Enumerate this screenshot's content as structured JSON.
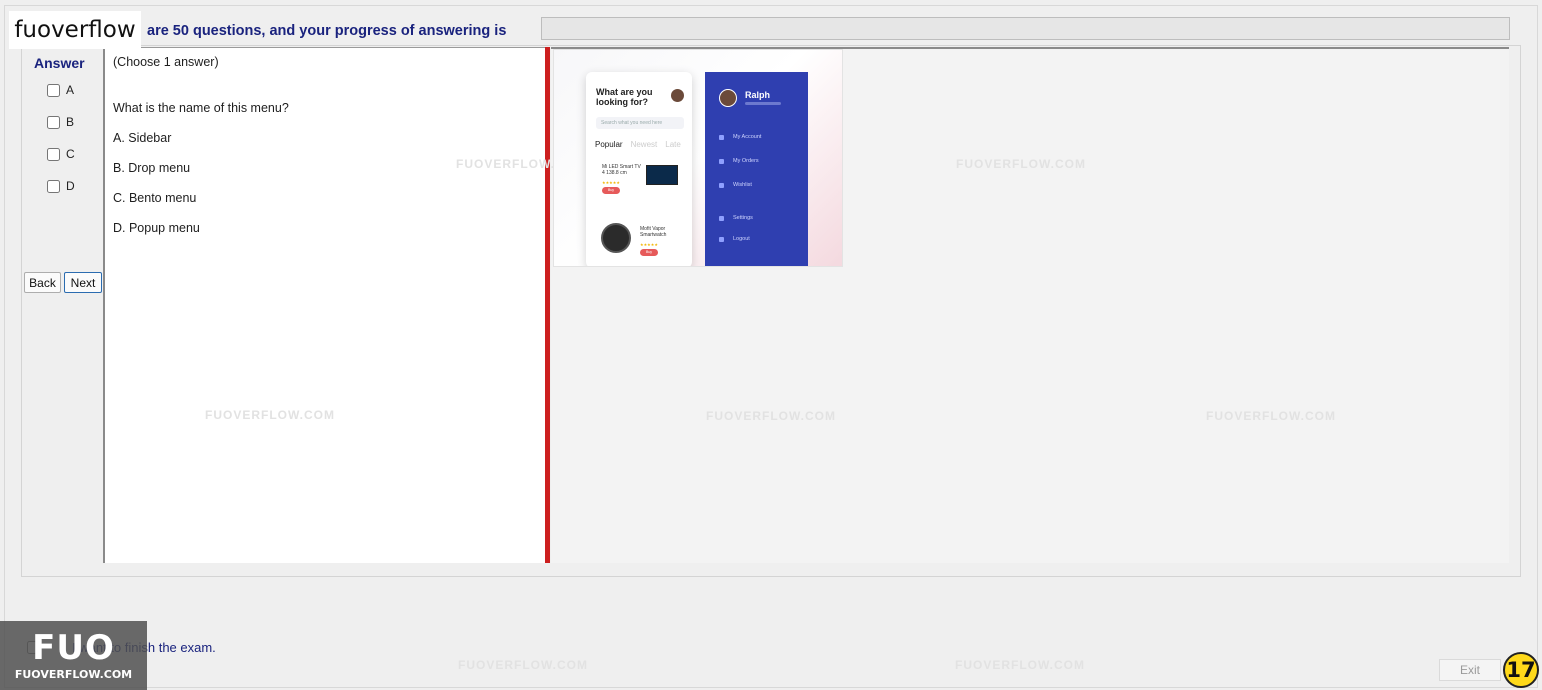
{
  "brand": {
    "top_label": "fuoverflow",
    "bottom_big": "FUO",
    "bottom_small": "FUOVERFLOW.COM"
  },
  "header": {
    "progress_text": "are 50 questions, and your progress of answering is",
    "progress_fraction": 0
  },
  "answer_panel": {
    "title": "Answer",
    "options": [
      "A",
      "B",
      "C",
      "D"
    ],
    "back_label": "Back",
    "next_label": "Next"
  },
  "question": {
    "instruction": "(Choose 1 answer)",
    "text": "What is the name of this menu?",
    "choices": [
      "A.  Sidebar",
      "B.  Drop menu",
      "C.  Bento menu",
      "D.  Popup menu"
    ]
  },
  "question_image": {
    "left_screen": {
      "header": "What are you looking for?",
      "search_placeholder": "Search what you need here",
      "tab_active": "Popular",
      "tab_2": "Newest",
      "tab_3": "Late",
      "product_1": "Mi LED Smart TV 4 138.8 cm",
      "product_2": "Mofit Vapor Smartwatch",
      "buy_label": "Buy"
    },
    "right_screen": {
      "user_name": "Ralph",
      "menu_items": [
        "My Account",
        "My Orders",
        "Wishlist",
        "Settings",
        "Logout"
      ]
    }
  },
  "watermarks": [
    "FUOVERFLOW.COM",
    "FUOVERFLOW.COM",
    "FUOVERFLOW.COM",
    "FUOVERFLOW.COM",
    "FUOVERFLOW.COM",
    "FUOVERFLOW.COM",
    "FUOVERFLOW.COM"
  ],
  "footer": {
    "finish_label": "I want to finish the exam.",
    "exit_label": "Exit",
    "badge": "17"
  },
  "colors": {
    "accent_text": "#1a237e",
    "splitter": "#cc1f1f",
    "menu_blue": "#2f3fb0",
    "badge": "#ffd91a"
  }
}
